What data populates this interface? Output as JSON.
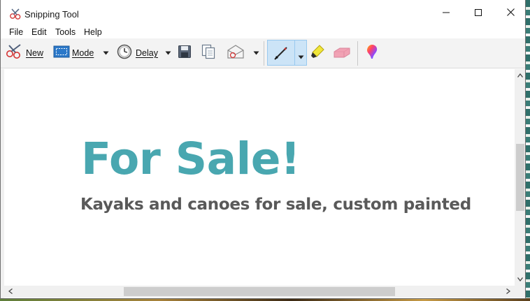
{
  "window": {
    "title": "Snipping Tool",
    "icon": "scissors-app-icon",
    "controls": [
      "minimize-icon",
      "maximize-icon",
      "close-icon"
    ]
  },
  "menu": {
    "items": [
      "File",
      "Edit",
      "Tools",
      "Help"
    ]
  },
  "toolbar": {
    "new_label": "New",
    "mode_label": "Mode",
    "delay_label": "Delay",
    "icons": [
      "scissors-icon",
      "mode-rectangle-icon",
      "clock-icon",
      "save-icon",
      "copy-icon",
      "send-snip-icon",
      "pen-icon",
      "highlighter-icon",
      "eraser-icon",
      "paint3d-icon"
    ],
    "selected_tool": "pen"
  },
  "content": {
    "headline": "For Sale!",
    "subline": "Kayaks and canoes for sale, custom painted",
    "headline_color": "#49a7b0",
    "subline_color": "#595959"
  }
}
